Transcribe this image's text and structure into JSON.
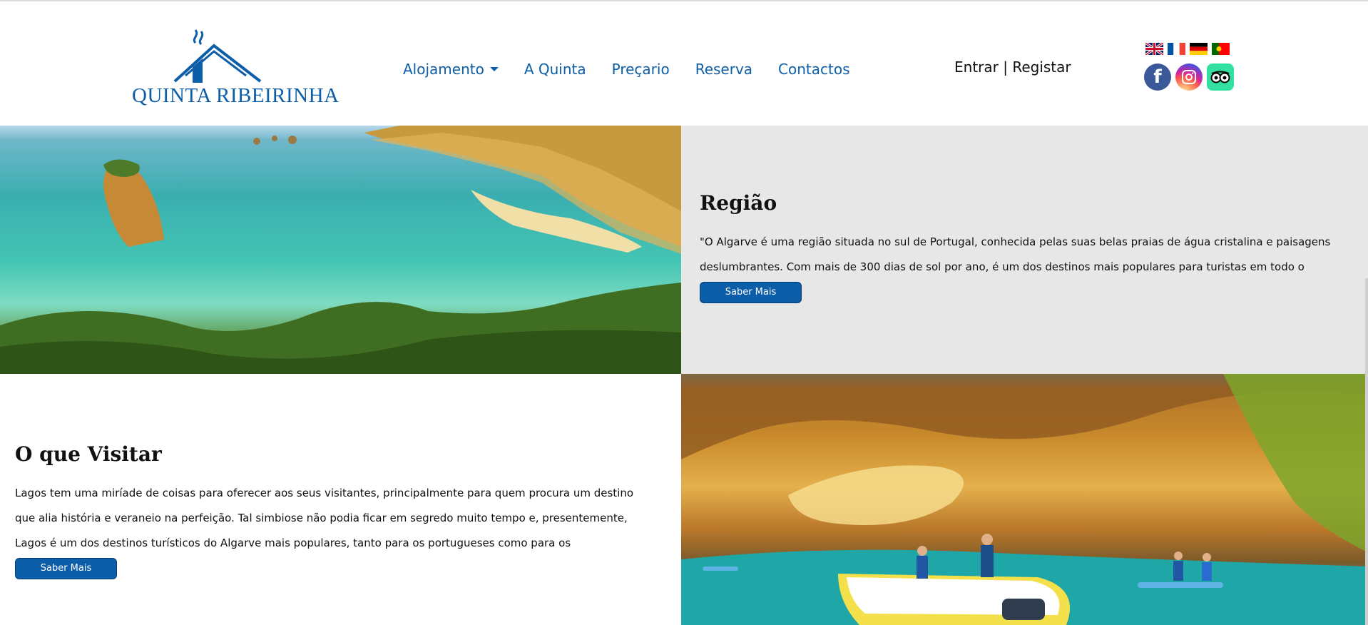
{
  "brand": {
    "name": "QUINTA RIBEIRINHA",
    "color": "#0d5ea8"
  },
  "nav": {
    "items": [
      {
        "label": "Alojamento",
        "has_dropdown": true
      },
      {
        "label": "A Quinta"
      },
      {
        "label": "Preçario"
      },
      {
        "label": "Reserva"
      },
      {
        "label": "Contactos"
      }
    ]
  },
  "auth": {
    "login": "Entrar",
    "separator": "|",
    "register": "Registar"
  },
  "languages": [
    {
      "icon": "uk-flag-icon"
    },
    {
      "icon": "france-flag-icon"
    },
    {
      "icon": "germany-flag-icon"
    },
    {
      "icon": "portugal-flag-icon"
    }
  ],
  "socials": [
    {
      "icon": "facebook-icon",
      "glyph": "f",
      "color": "#3b5998"
    },
    {
      "icon": "instagram-icon"
    },
    {
      "icon": "tripadvisor-icon",
      "color": "#34e0a1"
    }
  ],
  "region": {
    "title": "Região",
    "text": "\"O Algarve é uma região situada no sul de Portugal, conhecida pelas suas belas praias de água cristalina e paisagens deslumbrantes. Com mais de 300 dias de sol por ano, é um dos destinos mais populares para turistas em todo o mundo.\"",
    "button": "Saber Mais"
  },
  "visit": {
    "title": "O que Visitar",
    "text": "Lagos tem uma miríade de coisas para oferecer aos seus visitantes, principalmente para quem procura um destino que alia história e veraneio na perfeição. Tal simbiose não podia ficar em segredo muito tempo e, presentemente, Lagos é um dos destinos turísticos do Algarve mais populares, tanto para os portugueses como para os estrangeiros.",
    "button": "Saber Mais"
  },
  "colors": {
    "accent": "#0d5ea8",
    "panel": "#e7e7e7"
  }
}
